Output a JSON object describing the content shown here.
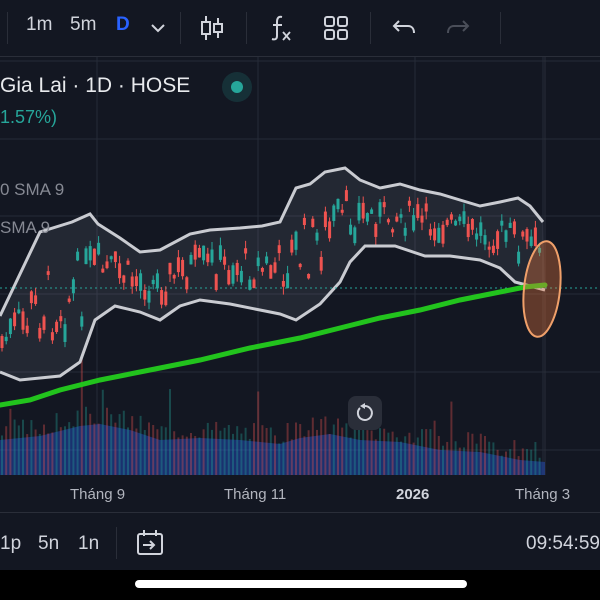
{
  "toolbar": {
    "interval_1m": "1m",
    "interval_5m": "5m",
    "interval_d": "D"
  },
  "legend": {
    "title": "Gia Lai · 1D · HOSE",
    "change": "1.57%)",
    "indicator_1": "0 SMA 9",
    "indicator_2": "SMA 9"
  },
  "xaxis": {
    "labels": [
      "Tháng 9",
      "Tháng 11",
      "2026",
      "Tháng 3"
    ]
  },
  "bottombar": {
    "range_1": "1p",
    "range_2": "5n",
    "range_3": "1n",
    "clock": "09:54:59"
  },
  "colors": {
    "background": "#131722",
    "up": "#26a69a",
    "down": "#ef5350",
    "bands": "#c9cbd1",
    "ma_long": "#22c31d",
    "volume": "#2962ff",
    "highlight": "#f0a06a"
  },
  "icons": [
    "chevron-down-icon",
    "candles-icon",
    "indicators-icon",
    "layout-icon",
    "undo-icon",
    "redo-icon",
    "replay-icon",
    "reset-icon"
  ]
}
